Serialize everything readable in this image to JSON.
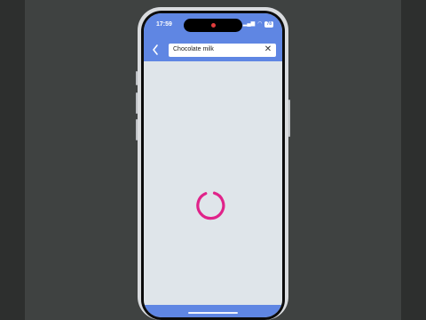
{
  "status_bar": {
    "time": "17:59",
    "battery": "78",
    "signal_icon": "signal-icon",
    "wifi_icon": "wifi-icon"
  },
  "search": {
    "query": "Chocolate milk"
  },
  "loading": {
    "spinner_color": "#e0238a"
  },
  "colors": {
    "toolbar": "#5f86e3",
    "content_bg": "#dfe5ea"
  }
}
